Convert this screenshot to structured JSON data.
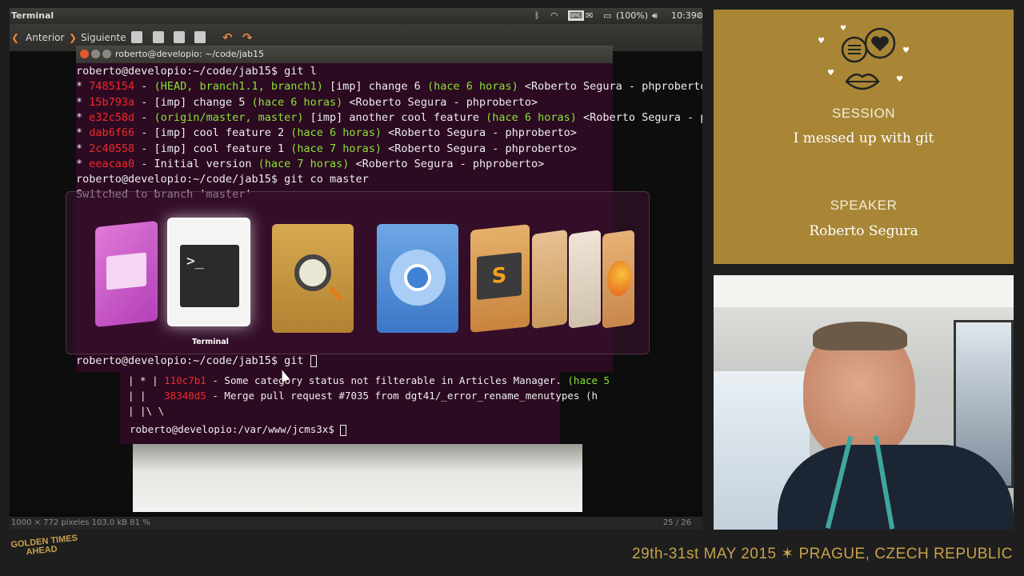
{
  "topbar": {
    "app_title": "Terminal",
    "battery": "(100%)",
    "clock": "10:39"
  },
  "navbar": {
    "prev_label": "Anterior",
    "next_label": "Siguiente"
  },
  "statusbar": {
    "image_info": "1000 × 772 píxeles  103,0 kB  81 %",
    "page_count": "25 / 26"
  },
  "terminal": {
    "window_title": "roberto@developio: ~/code/jab15",
    "lines": [
      [
        {
          "t": "roberto@developio:~/code/jab15$ git l",
          "c": "white"
        }
      ],
      [
        {
          "t": "* ",
          "c": "white"
        },
        {
          "t": "7485154",
          "c": "red"
        },
        {
          "t": " - ",
          "c": "white"
        },
        {
          "t": "(HEAD, branch1.1, branch1)",
          "c": "green"
        },
        {
          "t": " [imp] change 6 ",
          "c": "white"
        },
        {
          "t": "(hace 6 horas)",
          "c": "green"
        },
        {
          "t": " <Roberto Segura - phproberto",
          "c": "white"
        }
      ],
      [
        {
          "t": "* ",
          "c": "white"
        },
        {
          "t": "15b793a",
          "c": "red"
        },
        {
          "t": " - [imp] change 5 ",
          "c": "white"
        },
        {
          "t": "(hace 6 horas)",
          "c": "green"
        },
        {
          "t": " <Roberto Segura - phproberto>",
          "c": "white"
        }
      ],
      [
        {
          "t": "* ",
          "c": "white"
        },
        {
          "t": "e32c58d",
          "c": "red"
        },
        {
          "t": " - ",
          "c": "white"
        },
        {
          "t": "(origin/master, master)",
          "c": "green"
        },
        {
          "t": " [imp] another cool feature ",
          "c": "white"
        },
        {
          "t": "(hace 6 horas)",
          "c": "green"
        },
        {
          "t": " <Roberto Segura - p",
          "c": "white"
        }
      ],
      [
        {
          "t": "* ",
          "c": "white"
        },
        {
          "t": "dab6f66",
          "c": "red"
        },
        {
          "t": " - [imp] cool feature 2 ",
          "c": "white"
        },
        {
          "t": "(hace 6 horas)",
          "c": "green"
        },
        {
          "t": " <Roberto Segura - phproberto>",
          "c": "white"
        }
      ],
      [
        {
          "t": "* ",
          "c": "white"
        },
        {
          "t": "2c40558",
          "c": "red"
        },
        {
          "t": " - [imp] cool feature 1 ",
          "c": "white"
        },
        {
          "t": "(hace 7 horas)",
          "c": "green"
        },
        {
          "t": " <Roberto Segura - phproberto>",
          "c": "white"
        }
      ],
      [
        {
          "t": "* ",
          "c": "white"
        },
        {
          "t": "eeacaa0",
          "c": "red"
        },
        {
          "t": " - Initial version ",
          "c": "white"
        },
        {
          "t": "(hace 7 horas)",
          "c": "green"
        },
        {
          "t": " <Roberto Segura - phproberto>",
          "c": "white"
        }
      ],
      [
        {
          "t": "roberto@developio:~/code/jab15$ git co master",
          "c": "white"
        }
      ],
      [
        {
          "t": "Switched to branch 'master'",
          "c": "white"
        }
      ]
    ],
    "prompt_line": "roberto@developio:~/code/jab15$ git "
  },
  "terminal2": {
    "lines": [
      [
        {
          "t": "| * | ",
          "c": "white"
        },
        {
          "t": "110c7b1",
          "c": "red"
        },
        {
          "t": " - Some category status not filterable in Articles Manager. ",
          "c": "white"
        },
        {
          "t": "(hace 5",
          "c": "green"
        }
      ],
      [
        {
          "t": "| |   ",
          "c": "white"
        },
        {
          "t": "38340d5",
          "c": "red"
        },
        {
          "t": " - Merge pull request #7035 from dgt41/_error_rename_menutypes (h",
          "c": "white"
        }
      ],
      [
        {
          "t": "| |\\ \\",
          "c": "white"
        }
      ]
    ],
    "prompt_line": "roberto@developio:/var/www/jcms3x$ "
  },
  "switcher": {
    "selected_label": "Terminal",
    "apps": [
      "app-launcher-icon",
      "terminal-icon",
      "image-viewer-icon",
      "chromium-icon",
      "sublime-text-icon",
      "file-manager-icon",
      "text-editor-icon",
      "firefox-icon"
    ]
  },
  "session": {
    "session_heading": "SESSION",
    "session_title": "I messed up with git",
    "speaker_heading": "SPEAKER",
    "speaker_name": "Roberto Segura"
  },
  "footer": {
    "logo_lines": [
      "GOLDEN TIMES",
      "AHEAD"
    ],
    "event_text": "29th-31st MAY 2015 ✶ PRAGUE, CZECH REPUBLIC"
  },
  "colors": {
    "terminal_bg": "#2c0a22",
    "term_red": "#ef2929",
    "term_green": "#8ae234",
    "panel_gold": "#a88636",
    "ubuntu_orange": "#e8853a"
  }
}
